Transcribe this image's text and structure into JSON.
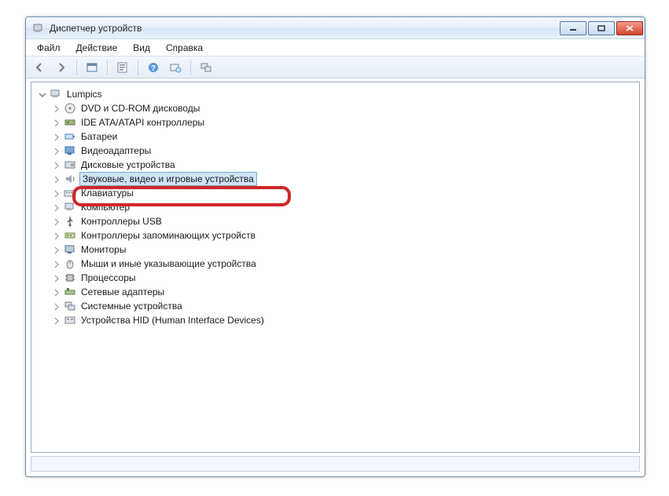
{
  "window": {
    "title": "Диспетчер устройств"
  },
  "menu": {
    "file": "Файл",
    "action": "Действие",
    "view": "Вид",
    "help": "Справка"
  },
  "tree": {
    "root": {
      "label": "Lumpics"
    },
    "items": [
      {
        "label": "DVD и CD-ROM дисководы"
      },
      {
        "label": "IDE ATA/ATAPI контроллеры"
      },
      {
        "label": "Батареи"
      },
      {
        "label": "Видеоадаптеры"
      },
      {
        "label": "Дисковые устройства"
      },
      {
        "label": "Звуковые, видео и игровые устройства"
      },
      {
        "label": "Клавиатуры"
      },
      {
        "label": "Компьютер"
      },
      {
        "label": "Контроллеры USB"
      },
      {
        "label": "Контроллеры запоминающих устройств"
      },
      {
        "label": "Мониторы"
      },
      {
        "label": "Мыши и иные указывающие устройства"
      },
      {
        "label": "Процессоры"
      },
      {
        "label": "Сетевые адаптеры"
      },
      {
        "label": "Системные устройства"
      },
      {
        "label": "Устройства HID (Human Interface Devices)"
      }
    ]
  }
}
